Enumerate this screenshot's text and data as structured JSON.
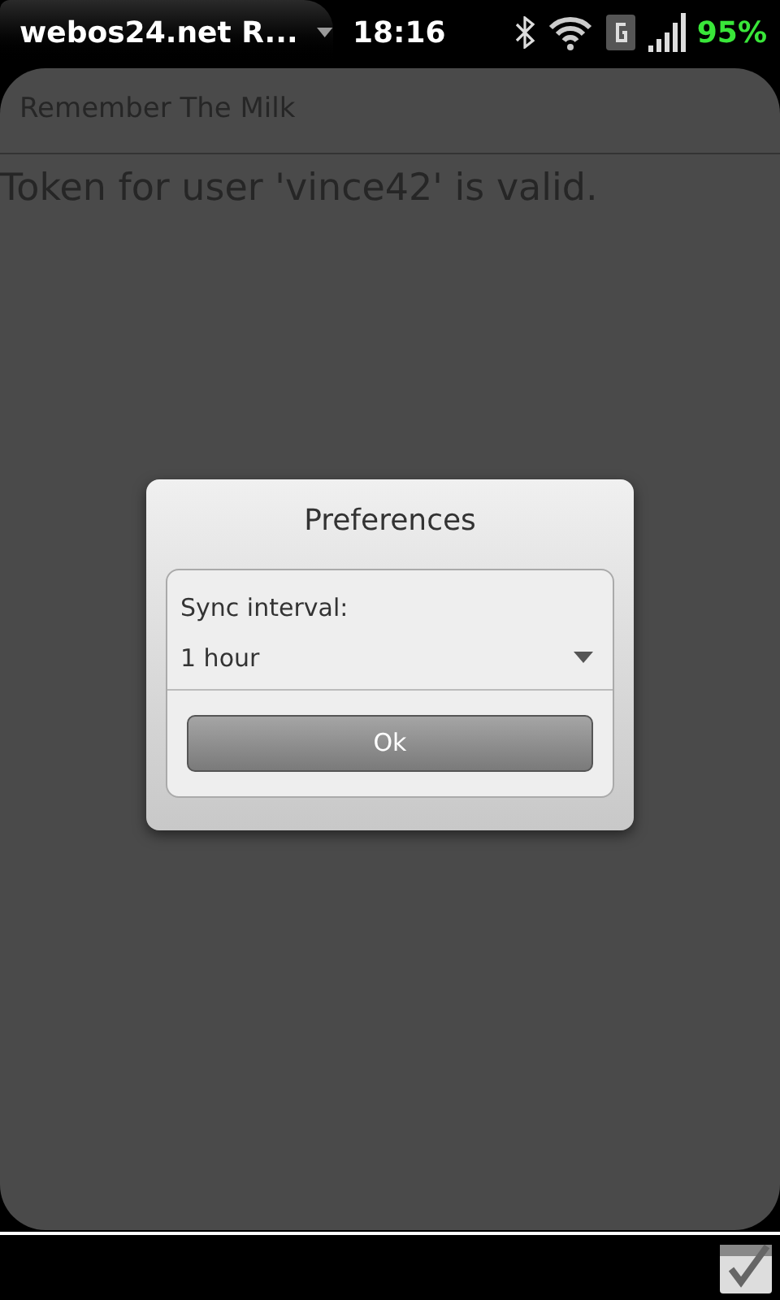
{
  "status_bar": {
    "app_title": "webos24.net R...",
    "time": "18:16",
    "battery": "95%"
  },
  "app": {
    "title": "Remember The Milk",
    "message": "Token for user 'vince42' is valid."
  },
  "dialog": {
    "title": "Preferences",
    "field": {
      "label": "Sync interval:",
      "value": "1 hour"
    },
    "button": "Ok"
  }
}
